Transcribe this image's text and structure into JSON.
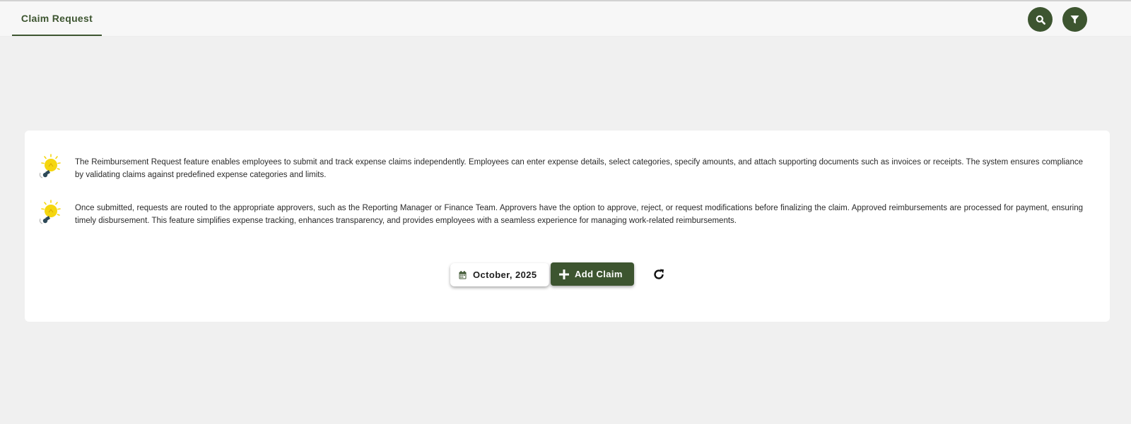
{
  "header": {
    "tab_label": "Claim Request",
    "search_icon": "search-icon",
    "filter_icon": "filter-icon"
  },
  "info": {
    "paragraphs": [
      "The Reimbursement Request feature enables employees to submit and track expense claims independently. Employees can enter expense details, select categories, specify amounts, and attach supporting documents such as invoices or receipts. The system ensures compliance by validating claims against predefined expense categories and limits.",
      "Once submitted, requests are routed to the appropriate approvers, such as the Reporting Manager or Finance Team. Approvers have the option to approve, reject, or request modifications before finalizing the claim. Approved reimbursements are processed for payment, ensuring timely disbursement. This feature simplifies expense tracking, enhances transparency, and provides employees with a seamless experience for managing work-related reimbursements."
    ],
    "icon": "lightbulb-icon"
  },
  "controls": {
    "month_label": "October, 2025",
    "add_claim_label": "Add Claim",
    "refresh_icon": "refresh-icon"
  },
  "colors": {
    "primary": "#3d5530",
    "background": "#f0f0f0",
    "card": "#ffffff",
    "bulb": "#f5d60f"
  }
}
